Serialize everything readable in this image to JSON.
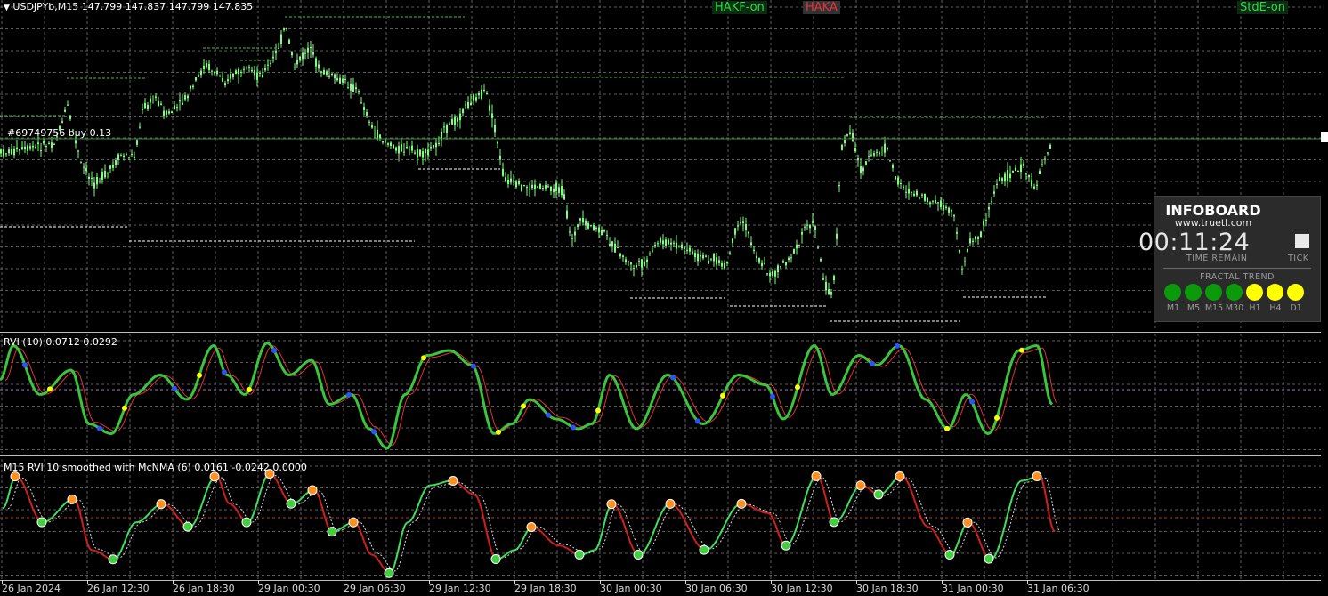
{
  "chart": {
    "symbol_info": "USDJPYb,M15  147.799 147.837 147.799 147.835",
    "order_label": "#69749756 buy 0.13",
    "flags": [
      "HAKF-on",
      "HAKA",
      "StdE-on"
    ],
    "colors": {
      "candles": "#7cff7c",
      "grid": "#6e6e6e",
      "background": "#000000"
    }
  },
  "indicator1": {
    "label": "RVI (10) 0.0712 0.0292"
  },
  "indicator2": {
    "label": "M15 RVI 10 smoothed with  McNMA (6) 0.0161 -0.0242 0.0000"
  },
  "xaxis": {
    "labels": [
      "26 Jan 2024",
      "26 Jan 12:30",
      "26 Jan 18:30",
      "29 Jan 00:30",
      "29 Jan 06:30",
      "29 Jan 12:30",
      "29 Jan 18:30",
      "30 Jan 00:30",
      "30 Jan 06:30",
      "30 Jan 12:30",
      "30 Jan 18:30",
      "31 Jan 00:30",
      "31 Jan 06:30"
    ]
  },
  "infoboard": {
    "title": "INFOBOARD",
    "url": "www.truetl.com",
    "timer": "00:11:24",
    "time_remain_label": "TIME REMAIN",
    "tick_label": "TICK",
    "fractal_trend_label": "FRACTAL TREND",
    "timeframes": [
      {
        "name": "M1",
        "color": "#0a9a0a"
      },
      {
        "name": "M5",
        "color": "#0a9a0a"
      },
      {
        "name": "M15",
        "color": "#0a9a0a"
      },
      {
        "name": "M30",
        "color": "#0a9a0a"
      },
      {
        "name": "H1",
        "color": "#ffff00"
      },
      {
        "name": "H4",
        "color": "#ffff00"
      },
      {
        "name": "D1",
        "color": "#ffff00"
      }
    ]
  }
}
